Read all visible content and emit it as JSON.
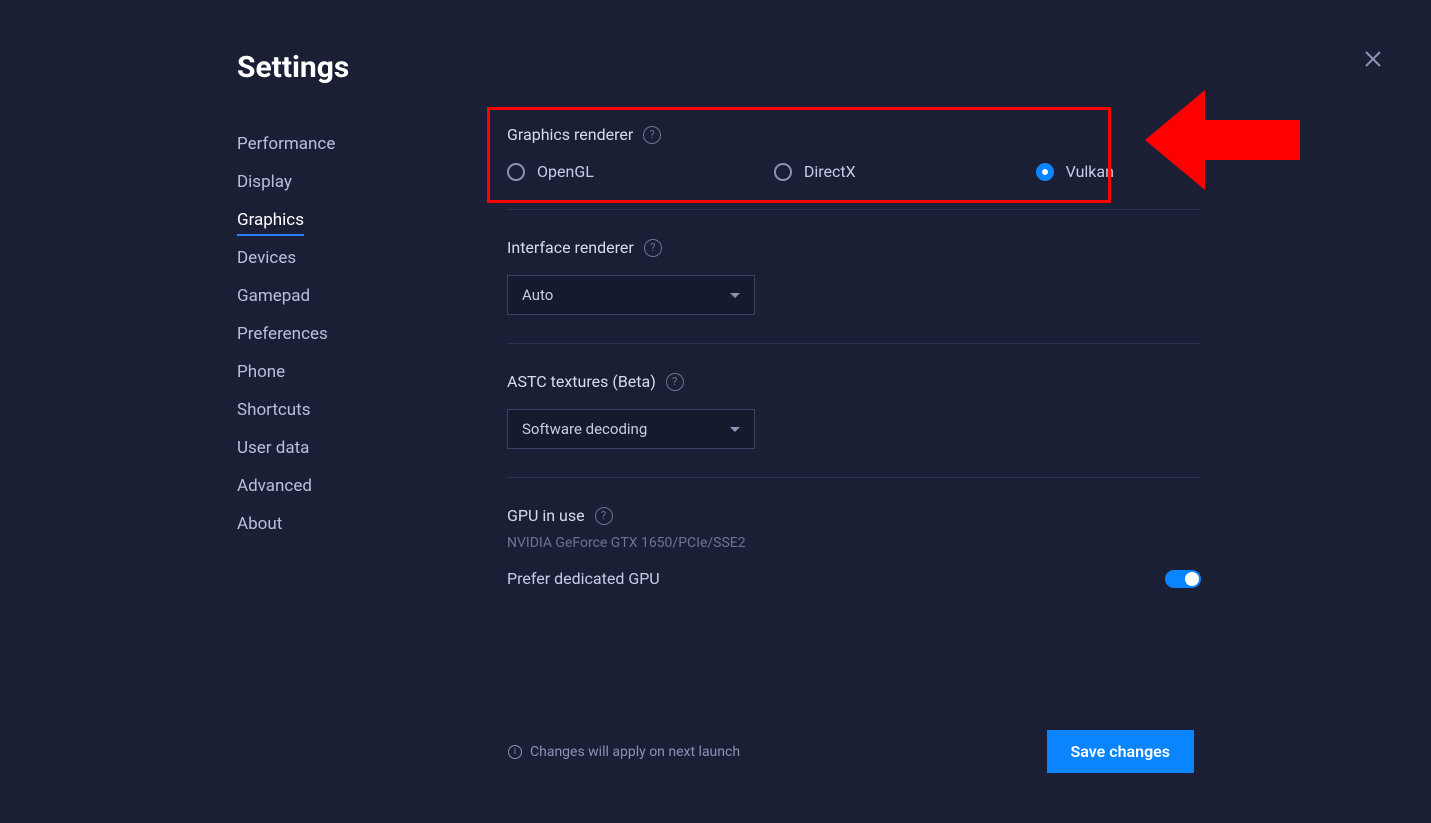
{
  "title": "Settings",
  "sidebar": {
    "items": [
      {
        "label": "Performance",
        "active": false
      },
      {
        "label": "Display",
        "active": false
      },
      {
        "label": "Graphics",
        "active": true
      },
      {
        "label": "Devices",
        "active": false
      },
      {
        "label": "Gamepad",
        "active": false
      },
      {
        "label": "Preferences",
        "active": false
      },
      {
        "label": "Phone",
        "active": false
      },
      {
        "label": "Shortcuts",
        "active": false
      },
      {
        "label": "User data",
        "active": false
      },
      {
        "label": "Advanced",
        "active": false
      },
      {
        "label": "About",
        "active": false
      }
    ]
  },
  "graphics_renderer": {
    "label": "Graphics renderer",
    "options": [
      {
        "label": "OpenGL",
        "selected": false
      },
      {
        "label": "DirectX",
        "selected": false
      },
      {
        "label": "Vulkan",
        "selected": true
      }
    ]
  },
  "interface_renderer": {
    "label": "Interface renderer",
    "value": "Auto"
  },
  "astc_textures": {
    "label": "ASTC textures (Beta)",
    "value": "Software decoding"
  },
  "gpu": {
    "label": "GPU in use",
    "info": "NVIDIA GeForce GTX 1650/PCIe/SSE2",
    "toggle_label": "Prefer dedicated GPU",
    "toggle_on": true
  },
  "footer": {
    "notice": "Changes will apply on next launch",
    "save_label": "Save changes"
  }
}
